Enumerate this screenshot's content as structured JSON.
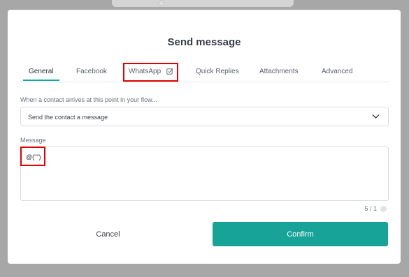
{
  "modal": {
    "title": "Send message"
  },
  "tabs": [
    {
      "label": "General",
      "active": true
    },
    {
      "label": "Facebook",
      "active": false
    },
    {
      "label": "WhatsApp",
      "active": false,
      "icon": "edit-check-icon"
    },
    {
      "label": "Quick Replies",
      "active": false
    },
    {
      "label": "Attachments",
      "active": false
    },
    {
      "label": "Advanced",
      "active": false
    }
  ],
  "trigger": {
    "label": "When a contact arrives at this point in your flow...",
    "value": "Send the contact a message",
    "icon": "chevron-down-icon"
  },
  "message": {
    "label": "Message",
    "value": "@(\"\")",
    "counter": "5 / 1"
  },
  "buttons": {
    "cancel": "Cancel",
    "confirm": "Confirm"
  },
  "colors": {
    "accent": "#17a398",
    "highlight": "#e30000",
    "overlay": "#a7a7a7"
  }
}
